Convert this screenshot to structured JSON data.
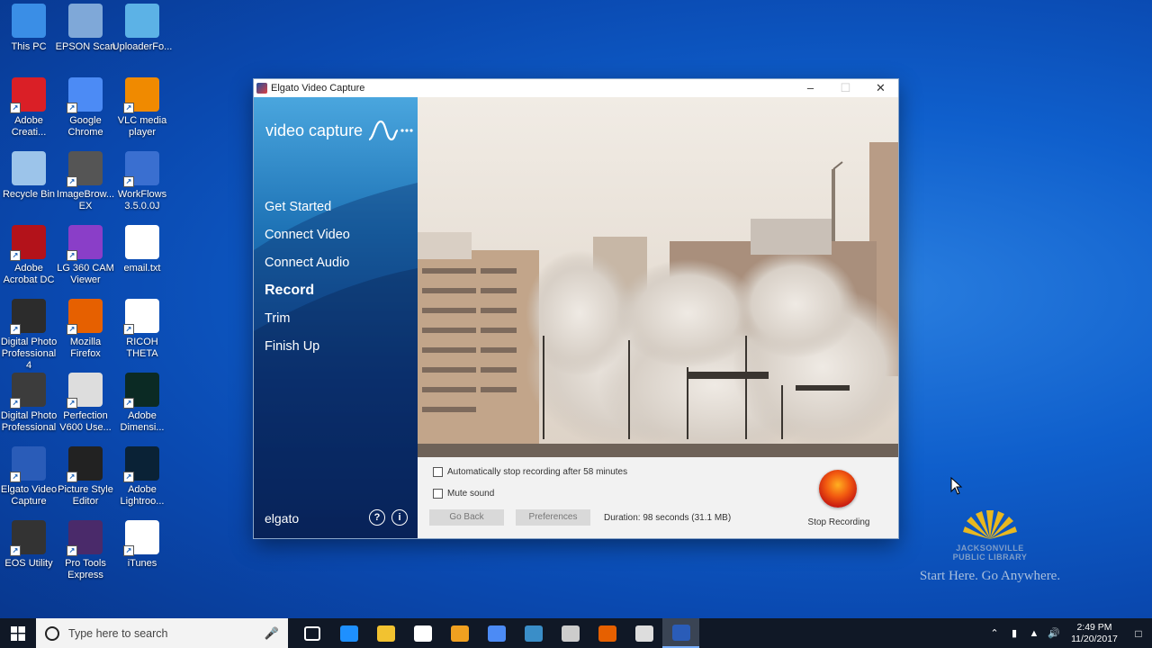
{
  "desktop": {
    "icons": [
      {
        "label": "This PC",
        "icon": "computer-icon",
        "color": "#3a8ee6"
      },
      {
        "label": "EPSON Scan",
        "icon": "scanner-icon",
        "color": "#7fa8d8"
      },
      {
        "label": "UploaderFo...",
        "icon": "uploader-icon",
        "color": "#5cb2e6"
      },
      {
        "label": "Adobe Creati...",
        "icon": "adobe-cc-icon",
        "color": "#da1f26"
      },
      {
        "label": "Google Chrome",
        "icon": "chrome-icon",
        "color": "#4c8bf5"
      },
      {
        "label": "VLC media player",
        "icon": "vlc-icon",
        "color": "#f08a00"
      },
      {
        "label": "Recycle Bin",
        "icon": "recycle-bin-icon",
        "color": "#9cc4ea"
      },
      {
        "label": "ImageBrow... EX",
        "icon": "camera-icon",
        "color": "#555555"
      },
      {
        "label": "WorkFlows 3.5.0.0J",
        "icon": "workflows-icon",
        "color": "#3a6fd0"
      },
      {
        "label": "Adobe Acrobat DC",
        "icon": "acrobat-icon",
        "color": "#b3121a"
      },
      {
        "label": "LG 360 CAM Viewer",
        "icon": "lg360-icon",
        "color": "#8a3ec8"
      },
      {
        "label": "email.txt",
        "icon": "text-file-icon",
        "color": "#ffffff"
      },
      {
        "label": "Digital Photo Professional 4",
        "icon": "dpp4-icon",
        "color": "#2c2c2c"
      },
      {
        "label": "Mozilla Firefox",
        "icon": "firefox-icon",
        "color": "#e66000"
      },
      {
        "label": "RICOH THETA",
        "icon": "ricoh-theta-icon",
        "color": "#ffffff"
      },
      {
        "label": "Digital Photo Professional",
        "icon": "dpp-icon",
        "color": "#3c3c3c"
      },
      {
        "label": "Perfection V600 Use...",
        "icon": "manual-icon",
        "color": "#dddddd"
      },
      {
        "label": "Adobe Dimensi...",
        "icon": "dimension-icon",
        "color": "#0b2a24"
      },
      {
        "label": "Elgato Video Capture",
        "icon": "elgato-icon",
        "color": "#2a5cb8"
      },
      {
        "label": "Picture Style Editor",
        "icon": "picture-style-icon",
        "color": "#222222"
      },
      {
        "label": "Adobe Lightroo...",
        "icon": "lightroom-icon",
        "color": "#0a2236"
      },
      {
        "label": "EOS Utility",
        "icon": "eos-utility-icon",
        "color": "#333333"
      },
      {
        "label": "Pro Tools Express",
        "icon": "pro-tools-icon",
        "color": "#4a2a6a"
      },
      {
        "label": "iTunes",
        "icon": "itunes-icon",
        "color": "#ffffff"
      }
    ]
  },
  "window": {
    "title": "Elgato Video Capture",
    "sidebar": {
      "brand": "video capture",
      "nav": [
        "Get Started",
        "Connect Video",
        "Connect Audio",
        "Record",
        "Trim",
        "Finish Up"
      ],
      "active": "Record",
      "footer_brand": "elgato",
      "help_glyph": "?",
      "info_glyph": "i"
    },
    "controls": {
      "auto_stop_label": "Automatically stop recording after 58 minutes",
      "auto_stop_checked": false,
      "mute_label": "Mute sound",
      "mute_checked": false,
      "go_back_label": "Go Back",
      "preferences_label": "Preferences",
      "duration_text": "Duration: 98 seconds (31.1 MB)",
      "stop_recording_label": "Stop Recording"
    }
  },
  "library_logo": {
    "name_line1": "JACKSONVILLE",
    "name_line2": "PUBLIC LIBRARY",
    "tagline": "Start Here. Go Anywhere."
  },
  "taskbar": {
    "search_placeholder": "Type here to search",
    "apps": [
      {
        "icon": "task-view-icon",
        "color": "#ffffff"
      },
      {
        "icon": "edge-icon",
        "color": "#1e90ff"
      },
      {
        "icon": "file-explorer-icon",
        "color": "#f2c230"
      },
      {
        "icon": "store-icon",
        "color": "#ffffff"
      },
      {
        "icon": "outlook-icon",
        "color": "#f0a020"
      },
      {
        "icon": "chrome-icon",
        "color": "#4c8bf5"
      },
      {
        "icon": "workflows-icon",
        "color": "#3a8ec8"
      },
      {
        "icon": "satellite-icon",
        "color": "#cccccc"
      },
      {
        "icon": "firefox-icon",
        "color": "#e66000"
      },
      {
        "icon": "obs-icon",
        "color": "#dddddd"
      },
      {
        "icon": "elgato-icon",
        "color": "#2a5cb8"
      }
    ],
    "active_app": "elgato-icon",
    "time": "2:49 PM",
    "date": "11/20/2017"
  }
}
